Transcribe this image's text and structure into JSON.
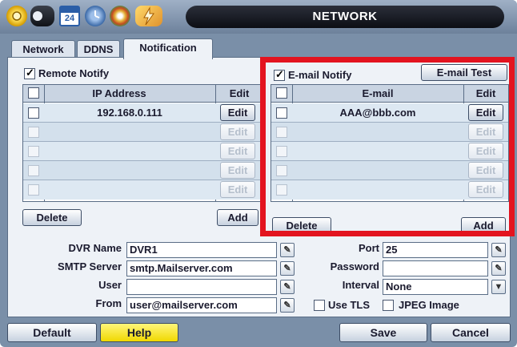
{
  "window": {
    "title": "NETWORK"
  },
  "toolbar": {
    "icons": [
      "gear-icon",
      "record-icon",
      "calendar-icon",
      "clock-icon",
      "disc-icon",
      "power-icon"
    ],
    "calendar_num": "24"
  },
  "tabs": [
    {
      "label": "Network",
      "active": false
    },
    {
      "label": "DDNS",
      "active": false
    },
    {
      "label": "Notification",
      "active": true
    }
  ],
  "remote": {
    "label": "Remote Notify",
    "checked": true,
    "col_ip": "IP Address",
    "col_edit": "Edit",
    "rows": [
      "192.168.0.111",
      "",
      "",
      "",
      ""
    ],
    "edit_label": "Edit",
    "delete_label": "Delete",
    "add_label": "Add"
  },
  "email": {
    "label": "E-mail Notify",
    "checked": true,
    "test_label": "E-mail Test",
    "col_email": "E-mail",
    "col_edit": "Edit",
    "rows": [
      "AAA@bbb.com",
      "",
      "",
      "",
      ""
    ],
    "edit_label": "Edit",
    "delete_label": "Delete",
    "add_label": "Add"
  },
  "form": {
    "dvr_name_label": "DVR Name",
    "dvr_name": "DVR1",
    "smtp_label": "SMTP Server",
    "smtp": "smtp.Mailserver.com",
    "user_label": "User",
    "user": "",
    "from_label": "From",
    "from": "user@mailserver.com",
    "port_label": "Port",
    "port": "25",
    "password_label": "Password",
    "password": "",
    "interval_label": "Interval",
    "interval": "None",
    "use_tls_label": "Use TLS",
    "use_tls": false,
    "jpeg_label": "JPEG Image",
    "jpeg": false
  },
  "footer": {
    "default_label": "Default",
    "help_label": "Help",
    "save_label": "Save",
    "cancel_label": "Cancel"
  },
  "colors": {
    "highlight": "#e3141f",
    "help": "#f0d800",
    "title_bg": "#0c0e14"
  }
}
